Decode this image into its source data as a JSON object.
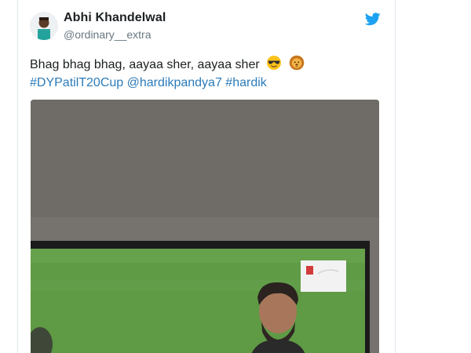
{
  "tweet": {
    "author_name": "Abhi Khandelwal",
    "author_handle": "@ordinary__extra",
    "text_line1": "Bhag bhag bhag, aayaa sher, aayaa sher",
    "hashtags": [
      {
        "text": "#DYPatilT20Cup"
      },
      {
        "text": "@hardikpandya7"
      },
      {
        "text": "#hardik"
      }
    ],
    "emojis": [
      "sunglasses-face",
      "lion-face"
    ]
  },
  "icons": {
    "brand": "twitter-bird-icon"
  },
  "colors": {
    "brand_blue": "#1da1f2",
    "link_blue": "#2b7bb9",
    "text": "#1c2022",
    "handle_grey": "#697882",
    "pitch_green": "#5f9a45"
  }
}
